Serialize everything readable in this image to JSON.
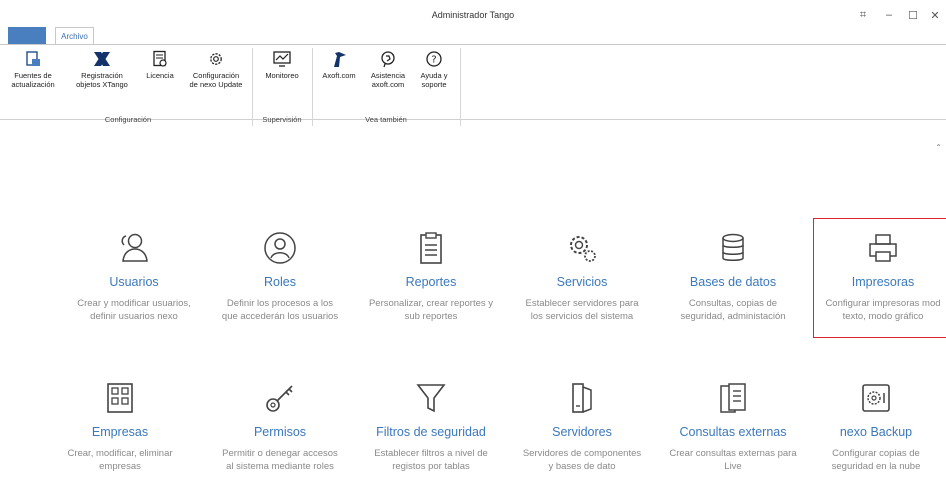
{
  "window": {
    "title": "Administrador Tango"
  },
  "tabs": {
    "archivo": "Archivo"
  },
  "ribbon": {
    "fuentes": "Fuentes de\nactualización",
    "registracion": "Registración\nobjetos XTango",
    "licencia": "Licencia",
    "configuracion_nexo": "Configuración\nde nexo Update",
    "monitoreo": "Monitoreo",
    "axoft": "Axoft.com",
    "asistencia": "Asistencia\naxoft.com",
    "ayuda": "Ayuda y\nsoporte",
    "group_configuracion": "Configuración",
    "group_supervision": "Supervisión",
    "group_vea": "Vea también"
  },
  "tiles": [
    {
      "title": "Usuarios",
      "desc": "Crear y modificar usuarios,\ndefinir usuarios nexo"
    },
    {
      "title": "Roles",
      "desc": "Definir los procesos a los\nque accederán los usuarios"
    },
    {
      "title": "Reportes",
      "desc": "Personalizar, crear reportes y\nsub reportes"
    },
    {
      "title": "Servicios",
      "desc": "Establecer servidores para\nlos servicios del sistema"
    },
    {
      "title": "Bases de datos",
      "desc": "Consultas, copias de\nseguridad, administación"
    },
    {
      "title": "Impresoras",
      "desc": "Configurar impresoras mod\ntexto, modo gráfico"
    },
    {
      "title": "Empresas",
      "desc": "Crear, modificar, eliminar\nempresas"
    },
    {
      "title": "Permisos",
      "desc": "Permitir o denegar accesos\nal sistema mediante roles"
    },
    {
      "title": "Filtros de seguridad",
      "desc": "Establecer filtros a nivel de\nregistos por tablas"
    },
    {
      "title": "Servidores",
      "desc": "Servidores de componentes\ny bases de dato"
    },
    {
      "title": "Consultas externas",
      "desc": "Crear consultas externas para\nLive"
    },
    {
      "title": "nexo Backup",
      "desc": "Configurar copias de\nseguridad en la nube"
    }
  ],
  "colors": {
    "accent": "#3b78bd",
    "selection": "#e0242b",
    "desc": "#8a8a8a"
  }
}
